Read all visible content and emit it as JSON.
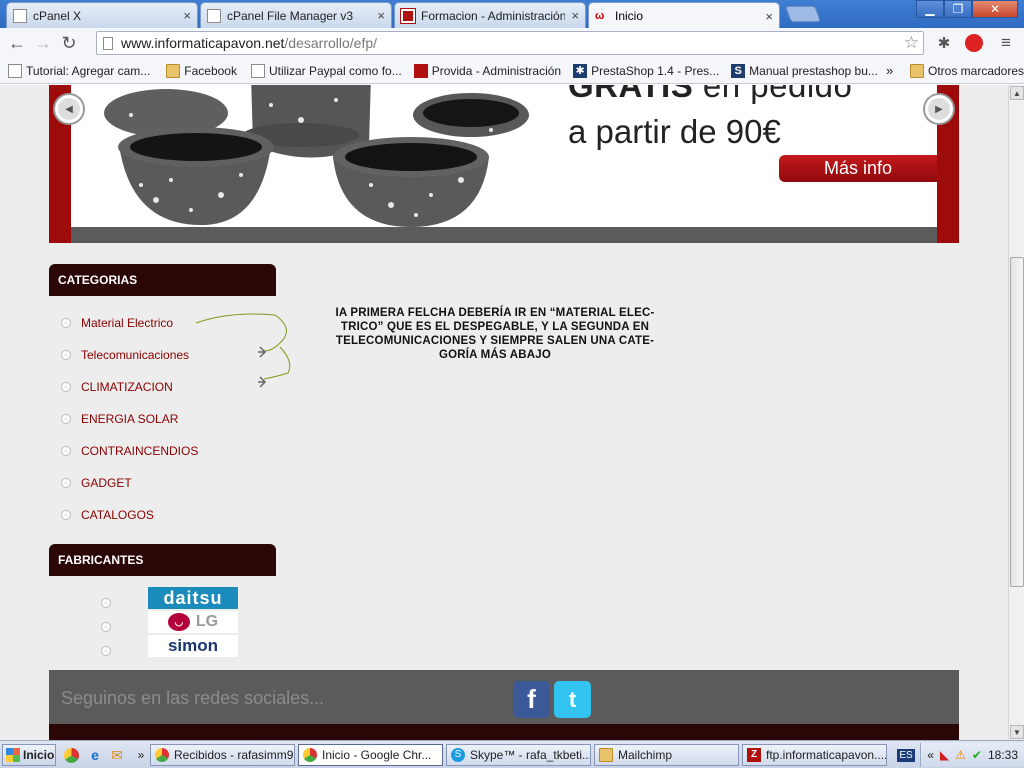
{
  "tabs": [
    {
      "title": "cPanel X",
      "close": "×"
    },
    {
      "title": "cPanel File Manager v3",
      "close": "×"
    },
    {
      "title": "Formacion - Administración",
      "close": "×"
    },
    {
      "title": "Inicio",
      "close": "×"
    }
  ],
  "window_buttons": {
    "minimize": "▁",
    "maximize": "❐",
    "close": "✕"
  },
  "toolbar": {
    "back": "←",
    "forward": "→",
    "reload": "↻",
    "url_domain": "www.informaticapavon.net",
    "url_path": "/desarrollo/efp/",
    "star": "☆",
    "menu": "≡"
  },
  "bookmarks": [
    {
      "label": "Tutorial: Agregar cam...",
      "icon": "page-icon"
    },
    {
      "label": "Facebook",
      "icon": "folder-icon"
    },
    {
      "label": "Utilizar Paypal como fo...",
      "icon": "page-icon"
    },
    {
      "label": "Provida - Administración",
      "icon": "prestashop-icon"
    },
    {
      "label": "PrestaShop 1.4 - Pres...",
      "icon": "prestashop-icon"
    },
    {
      "label": "Manual prestashop bu...",
      "icon": "s-icon"
    }
  ],
  "bookmarks_overflow": "»",
  "bookmarks_other": "Otros marcadores",
  "banner": {
    "line1_bold": "GRATIS",
    "line1_rest": " en pedido",
    "line2": "a partir de 90€",
    "button": "Más info",
    "prev": "◀",
    "next": "▶"
  },
  "categories": {
    "title": "CATEGORIAS",
    "items": [
      "Material Electrico",
      "Telecomunicaciones",
      "CLIMATIZACION",
      "ENERGIA SOLAR",
      "CONTRAINCENDIOS",
      "GADGET",
      "CATALOGOS"
    ]
  },
  "note": "IA PRIMERA FELCHA DEBERÍA IR EN “MATERIAL ELEC-TRICO” QUE ES EL DESPEGABLE, Y LA SEGUNDA EN TELECOMUNICACIONES Y SIEMPRE SALEN UNA CATE-GORÍA MÁS ABAJO",
  "manufacturers": {
    "title": "FABRICANTES",
    "logos": [
      "daitsu",
      "LG",
      "simon"
    ]
  },
  "footer": {
    "social_text": "Seguinos en las redes sociales...",
    "facebook": "f",
    "twitter": "t"
  },
  "taskbar": {
    "start": "Inicio",
    "overflow": "»",
    "items": [
      "Recibidos - rafasimm9...",
      "Inicio - Google Chr...",
      "Skype™ - rafa_tkbeti...",
      "Mailchimp",
      "ftp.informaticapavon...."
    ],
    "lang": "ES",
    "tray_overflow": "«",
    "clock": "18:33"
  },
  "colors": {
    "brand_dark": "#2a0606",
    "brand_red": "#9d0b0b",
    "link": "#8b0000",
    "footer_bg": "#5b5b5b"
  }
}
